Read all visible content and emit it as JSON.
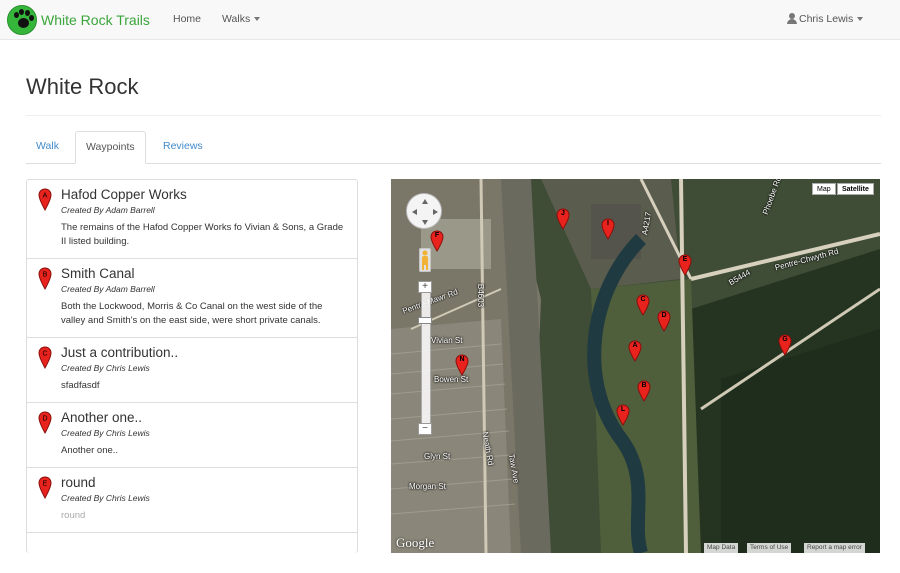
{
  "navbar": {
    "brand": "White Rock Trails",
    "home": "Home",
    "walks": "Walks",
    "user": "Chris Lewis"
  },
  "page": {
    "title": "White Rock"
  },
  "tabs": [
    {
      "label": "Walk",
      "active": false
    },
    {
      "label": "Waypoints",
      "active": true
    },
    {
      "label": "Reviews",
      "active": false
    }
  ],
  "waypoints": [
    {
      "letter": "A",
      "title": "Hafod Copper Works",
      "created_by": "Created By Adam Barrell",
      "description": "The remains of the Hafod Copper Works fo Vivian & Sons, a Grade II listed building."
    },
    {
      "letter": "B",
      "title": "Smith Canal",
      "created_by": "Created By Adam Barrell",
      "description": "Both the Lockwood, Morris & Co Canal on the west side of the valley and Smith's on the east side, were short private canals."
    },
    {
      "letter": "C",
      "title": "Just a contribution..",
      "created_by": "Created By Chris Lewis",
      "description": "sfadfasdf"
    },
    {
      "letter": "D",
      "title": "Another one..",
      "created_by": "Created By Chris Lewis",
      "description": "Another one.."
    },
    {
      "letter": "E",
      "title": "round",
      "created_by": "Created By Chris Lewis",
      "description": "round"
    }
  ],
  "map": {
    "type_buttons": {
      "map": "Map",
      "satellite": "Satellite"
    },
    "zoom_in": "+",
    "zoom_out": "−",
    "logo": "Google",
    "footer": {
      "map_data": "Map Data",
      "terms": "Terms of Use",
      "report": "Report a map error"
    },
    "road_labels": [
      "Pentre-Mawr Rd",
      "B4603",
      "Vivian St",
      "Bowen St",
      "Glyn St",
      "Morgan St",
      "Neath Rd",
      "Taw Ave",
      "A4217",
      "Pentre-Chwyth Rd",
      "B5444",
      "Phoebe Rd"
    ],
    "markers": [
      "J",
      "I",
      "F",
      "E",
      "C",
      "D",
      "A",
      "B",
      "G",
      "N",
      "L"
    ],
    "colors": {
      "marker": "#e8221c",
      "marker_stroke": "#8a0f0c"
    }
  }
}
